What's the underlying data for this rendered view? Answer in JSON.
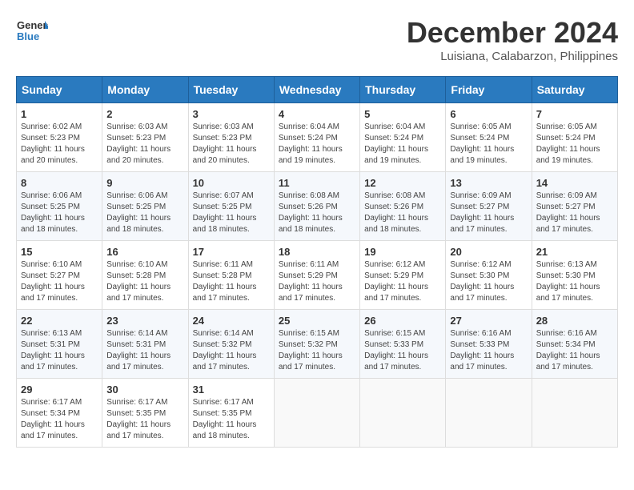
{
  "logo": {
    "line1": "General",
    "line2": "Blue"
  },
  "title": "December 2024",
  "location": "Luisiana, Calabarzon, Philippines",
  "weekdays": [
    "Sunday",
    "Monday",
    "Tuesday",
    "Wednesday",
    "Thursday",
    "Friday",
    "Saturday"
  ],
  "weeks": [
    [
      {
        "day": "1",
        "info": "Sunrise: 6:02 AM\nSunset: 5:23 PM\nDaylight: 11 hours\nand 20 minutes."
      },
      {
        "day": "2",
        "info": "Sunrise: 6:03 AM\nSunset: 5:23 PM\nDaylight: 11 hours\nand 20 minutes."
      },
      {
        "day": "3",
        "info": "Sunrise: 6:03 AM\nSunset: 5:23 PM\nDaylight: 11 hours\nand 20 minutes."
      },
      {
        "day": "4",
        "info": "Sunrise: 6:04 AM\nSunset: 5:24 PM\nDaylight: 11 hours\nand 19 minutes."
      },
      {
        "day": "5",
        "info": "Sunrise: 6:04 AM\nSunset: 5:24 PM\nDaylight: 11 hours\nand 19 minutes."
      },
      {
        "day": "6",
        "info": "Sunrise: 6:05 AM\nSunset: 5:24 PM\nDaylight: 11 hours\nand 19 minutes."
      },
      {
        "day": "7",
        "info": "Sunrise: 6:05 AM\nSunset: 5:24 PM\nDaylight: 11 hours\nand 19 minutes."
      }
    ],
    [
      {
        "day": "8",
        "info": "Sunrise: 6:06 AM\nSunset: 5:25 PM\nDaylight: 11 hours\nand 18 minutes."
      },
      {
        "day": "9",
        "info": "Sunrise: 6:06 AM\nSunset: 5:25 PM\nDaylight: 11 hours\nand 18 minutes."
      },
      {
        "day": "10",
        "info": "Sunrise: 6:07 AM\nSunset: 5:25 PM\nDaylight: 11 hours\nand 18 minutes."
      },
      {
        "day": "11",
        "info": "Sunrise: 6:08 AM\nSunset: 5:26 PM\nDaylight: 11 hours\nand 18 minutes."
      },
      {
        "day": "12",
        "info": "Sunrise: 6:08 AM\nSunset: 5:26 PM\nDaylight: 11 hours\nand 18 minutes."
      },
      {
        "day": "13",
        "info": "Sunrise: 6:09 AM\nSunset: 5:27 PM\nDaylight: 11 hours\nand 17 minutes."
      },
      {
        "day": "14",
        "info": "Sunrise: 6:09 AM\nSunset: 5:27 PM\nDaylight: 11 hours\nand 17 minutes."
      }
    ],
    [
      {
        "day": "15",
        "info": "Sunrise: 6:10 AM\nSunset: 5:27 PM\nDaylight: 11 hours\nand 17 minutes."
      },
      {
        "day": "16",
        "info": "Sunrise: 6:10 AM\nSunset: 5:28 PM\nDaylight: 11 hours\nand 17 minutes."
      },
      {
        "day": "17",
        "info": "Sunrise: 6:11 AM\nSunset: 5:28 PM\nDaylight: 11 hours\nand 17 minutes."
      },
      {
        "day": "18",
        "info": "Sunrise: 6:11 AM\nSunset: 5:29 PM\nDaylight: 11 hours\nand 17 minutes."
      },
      {
        "day": "19",
        "info": "Sunrise: 6:12 AM\nSunset: 5:29 PM\nDaylight: 11 hours\nand 17 minutes."
      },
      {
        "day": "20",
        "info": "Sunrise: 6:12 AM\nSunset: 5:30 PM\nDaylight: 11 hours\nand 17 minutes."
      },
      {
        "day": "21",
        "info": "Sunrise: 6:13 AM\nSunset: 5:30 PM\nDaylight: 11 hours\nand 17 minutes."
      }
    ],
    [
      {
        "day": "22",
        "info": "Sunrise: 6:13 AM\nSunset: 5:31 PM\nDaylight: 11 hours\nand 17 minutes."
      },
      {
        "day": "23",
        "info": "Sunrise: 6:14 AM\nSunset: 5:31 PM\nDaylight: 11 hours\nand 17 minutes."
      },
      {
        "day": "24",
        "info": "Sunrise: 6:14 AM\nSunset: 5:32 PM\nDaylight: 11 hours\nand 17 minutes."
      },
      {
        "day": "25",
        "info": "Sunrise: 6:15 AM\nSunset: 5:32 PM\nDaylight: 11 hours\nand 17 minutes."
      },
      {
        "day": "26",
        "info": "Sunrise: 6:15 AM\nSunset: 5:33 PM\nDaylight: 11 hours\nand 17 minutes."
      },
      {
        "day": "27",
        "info": "Sunrise: 6:16 AM\nSunset: 5:33 PM\nDaylight: 11 hours\nand 17 minutes."
      },
      {
        "day": "28",
        "info": "Sunrise: 6:16 AM\nSunset: 5:34 PM\nDaylight: 11 hours\nand 17 minutes."
      }
    ],
    [
      {
        "day": "29",
        "info": "Sunrise: 6:17 AM\nSunset: 5:34 PM\nDaylight: 11 hours\nand 17 minutes."
      },
      {
        "day": "30",
        "info": "Sunrise: 6:17 AM\nSunset: 5:35 PM\nDaylight: 11 hours\nand 17 minutes."
      },
      {
        "day": "31",
        "info": "Sunrise: 6:17 AM\nSunset: 5:35 PM\nDaylight: 11 hours\nand 18 minutes."
      },
      {
        "day": "",
        "info": ""
      },
      {
        "day": "",
        "info": ""
      },
      {
        "day": "",
        "info": ""
      },
      {
        "day": "",
        "info": ""
      }
    ]
  ]
}
